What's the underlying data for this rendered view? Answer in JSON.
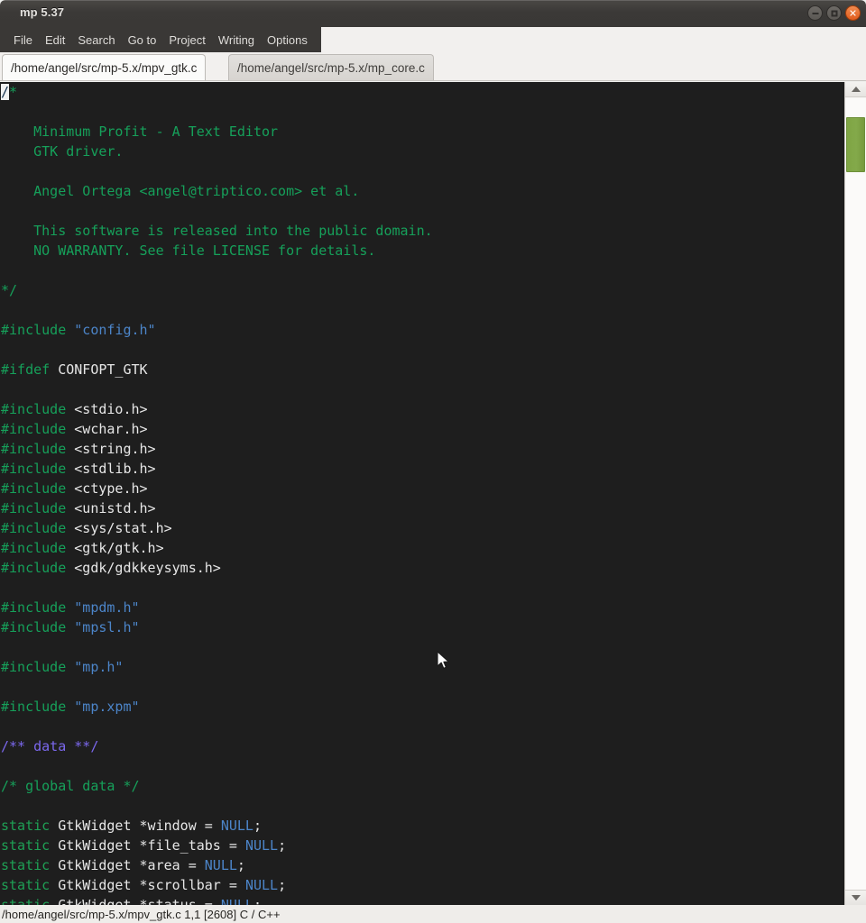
{
  "window": {
    "title": "mp 5.37",
    "buttons": [
      {
        "name": "minimize",
        "glyph": ""
      },
      {
        "name": "maximize",
        "glyph": ""
      },
      {
        "name": "close",
        "glyph": "✕"
      }
    ]
  },
  "menubar": {
    "items": [
      {
        "label": "File"
      },
      {
        "label": "Edit"
      },
      {
        "label": "Search"
      },
      {
        "label": "Go to"
      },
      {
        "label": "Project"
      },
      {
        "label": "Writing"
      },
      {
        "label": "Options"
      }
    ]
  },
  "tabs": [
    {
      "label": "/home/angel/src/mp-5.x/mpv_gtk.c",
      "active": true
    },
    {
      "label": "/home/angel/src/mp-5.x/mp_core.c",
      "active": false
    }
  ],
  "editor": {
    "language": "C / C++",
    "filename": "/home/angel/src/mp-5.x/mpv_gtk.c",
    "cursor_line": 1,
    "cursor_col": 1,
    "total_chars": 2608,
    "cursor_char": "/",
    "background": "#1e1e1e",
    "colors": {
      "comment": "#16a05a",
      "keyword": "#1fa055",
      "string": "#4c85c9",
      "constant": "#4c85c9",
      "doc_comment": "#7b68ee",
      "plain": "#e6e6e6",
      "cursor_bg": "#f2f2f2"
    },
    "lines": [
      [
        {
          "t": "/",
          "c": "cursor"
        },
        {
          "t": "*",
          "c": "cm"
        }
      ],
      [],
      [
        {
          "t": "    Minimum Profit - A Text Editor",
          "c": "cm"
        }
      ],
      [
        {
          "t": "    GTK driver.",
          "c": "cm"
        }
      ],
      [],
      [
        {
          "t": "    Angel Ortega <angel@triptico.com> et al.",
          "c": "cm"
        }
      ],
      [],
      [
        {
          "t": "    This software is released into the public domain.",
          "c": "cm"
        }
      ],
      [
        {
          "t": "    NO WARRANTY. See file LICENSE for details.",
          "c": "cm"
        }
      ],
      [],
      [
        {
          "t": "*/",
          "c": "cm"
        }
      ],
      [],
      [
        {
          "t": "#include ",
          "c": "cm"
        },
        {
          "t": "\"config.h\"",
          "c": "str"
        }
      ],
      [],
      [
        {
          "t": "#ifdef ",
          "c": "cm"
        },
        {
          "t": "CONFOPT_GTK",
          "c": "pl"
        }
      ],
      [],
      [
        {
          "t": "#include ",
          "c": "cm"
        },
        {
          "t": "<stdio.h>",
          "c": "pl"
        }
      ],
      [
        {
          "t": "#include ",
          "c": "cm"
        },
        {
          "t": "<wchar.h>",
          "c": "pl"
        }
      ],
      [
        {
          "t": "#include ",
          "c": "cm"
        },
        {
          "t": "<string.h>",
          "c": "pl"
        }
      ],
      [
        {
          "t": "#include ",
          "c": "cm"
        },
        {
          "t": "<stdlib.h>",
          "c": "pl"
        }
      ],
      [
        {
          "t": "#include ",
          "c": "cm"
        },
        {
          "t": "<ctype.h>",
          "c": "pl"
        }
      ],
      [
        {
          "t": "#include ",
          "c": "cm"
        },
        {
          "t": "<unistd.h>",
          "c": "pl"
        }
      ],
      [
        {
          "t": "#include ",
          "c": "cm"
        },
        {
          "t": "<sys/stat.h>",
          "c": "pl"
        }
      ],
      [
        {
          "t": "#include ",
          "c": "cm"
        },
        {
          "t": "<gtk/gtk.h>",
          "c": "pl"
        }
      ],
      [
        {
          "t": "#include ",
          "c": "cm"
        },
        {
          "t": "<gdk/gdkkeysyms.h>",
          "c": "pl"
        }
      ],
      [],
      [
        {
          "t": "#include ",
          "c": "cm"
        },
        {
          "t": "\"mpdm.h\"",
          "c": "str"
        }
      ],
      [
        {
          "t": "#include ",
          "c": "cm"
        },
        {
          "t": "\"mpsl.h\"",
          "c": "str"
        }
      ],
      [],
      [
        {
          "t": "#include ",
          "c": "cm"
        },
        {
          "t": "\"mp.h\"",
          "c": "str"
        }
      ],
      [],
      [
        {
          "t": "#include ",
          "c": "cm"
        },
        {
          "t": "\"mp.xpm\"",
          "c": "str"
        }
      ],
      [],
      [
        {
          "t": "/** data **/",
          "c": "doc"
        }
      ],
      [],
      [
        {
          "t": "/* global data */",
          "c": "cm"
        }
      ],
      [],
      [
        {
          "t": "static",
          "c": "kw"
        },
        {
          "t": " GtkWidget *window = ",
          "c": "pl"
        },
        {
          "t": "NULL",
          "c": "cnst"
        },
        {
          "t": ";",
          "c": "pl"
        }
      ],
      [
        {
          "t": "static",
          "c": "kw"
        },
        {
          "t": " GtkWidget *file_tabs = ",
          "c": "pl"
        },
        {
          "t": "NULL",
          "c": "cnst"
        },
        {
          "t": ";",
          "c": "pl"
        }
      ],
      [
        {
          "t": "static",
          "c": "kw"
        },
        {
          "t": " GtkWidget *area = ",
          "c": "pl"
        },
        {
          "t": "NULL",
          "c": "cnst"
        },
        {
          "t": ";",
          "c": "pl"
        }
      ],
      [
        {
          "t": "static",
          "c": "kw"
        },
        {
          "t": " GtkWidget *scrollbar = ",
          "c": "pl"
        },
        {
          "t": "NULL",
          "c": "cnst"
        },
        {
          "t": ";",
          "c": "pl"
        }
      ],
      [
        {
          "t": "static",
          "c": "kw"
        },
        {
          "t": " GtkWidget *status = ",
          "c": "pl"
        },
        {
          "t": "NULL",
          "c": "cnst"
        },
        {
          "t": ";",
          "c": "pl"
        }
      ]
    ]
  },
  "scrollbar": {
    "up_arrow": "▲",
    "down_arrow": "▼",
    "thumb_color": "#7fa544"
  },
  "statusbar": {
    "text": "/home/angel/src/mp-5.x/mpv_gtk.c 1,1 [2608] C / C++"
  }
}
